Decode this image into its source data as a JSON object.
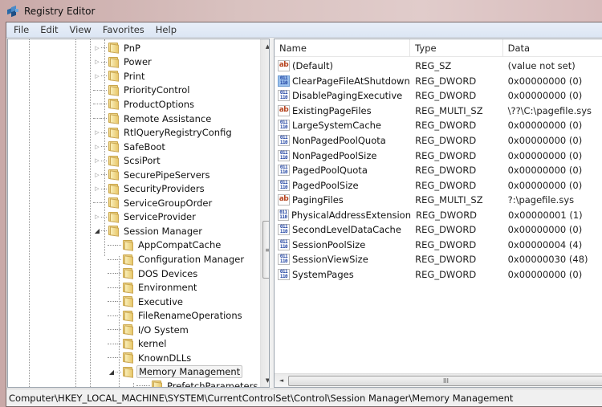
{
  "window": {
    "title": "Registry Editor",
    "icon": "regedit-icon"
  },
  "menu": [
    {
      "label": "File"
    },
    {
      "label": "Edit"
    },
    {
      "label": "View"
    },
    {
      "label": "Favorites"
    },
    {
      "label": "Help"
    }
  ],
  "tree": {
    "nodes": [
      {
        "label": "PnP",
        "level": 3,
        "expander": "collapsed"
      },
      {
        "label": "Power",
        "level": 3,
        "expander": "collapsed"
      },
      {
        "label": "Print",
        "level": 3,
        "expander": "collapsed"
      },
      {
        "label": "PriorityControl",
        "level": 3,
        "expander": "none"
      },
      {
        "label": "ProductOptions",
        "level": 3,
        "expander": "none"
      },
      {
        "label": "Remote Assistance",
        "level": 3,
        "expander": "none"
      },
      {
        "label": "RtlQueryRegistryConfig",
        "level": 3,
        "expander": "collapsed"
      },
      {
        "label": "SafeBoot",
        "level": 3,
        "expander": "collapsed"
      },
      {
        "label": "ScsiPort",
        "level": 3,
        "expander": "collapsed"
      },
      {
        "label": "SecurePipeServers",
        "level": 3,
        "expander": "collapsed"
      },
      {
        "label": "SecurityProviders",
        "level": 3,
        "expander": "collapsed"
      },
      {
        "label": "ServiceGroupOrder",
        "level": 3,
        "expander": "none"
      },
      {
        "label": "ServiceProvider",
        "level": 3,
        "expander": "collapsed"
      },
      {
        "label": "Session Manager",
        "level": 3,
        "expander": "expanded"
      },
      {
        "label": "AppCompatCache",
        "level": 4,
        "expander": "none"
      },
      {
        "label": "Configuration Manager",
        "level": 4,
        "expander": "none"
      },
      {
        "label": "DOS Devices",
        "level": 4,
        "expander": "none"
      },
      {
        "label": "Environment",
        "level": 4,
        "expander": "none"
      },
      {
        "label": "Executive",
        "level": 4,
        "expander": "none"
      },
      {
        "label": "FileRenameOperations",
        "level": 4,
        "expander": "none"
      },
      {
        "label": "I/O System",
        "level": 4,
        "expander": "none"
      },
      {
        "label": "kernel",
        "level": 4,
        "expander": "none"
      },
      {
        "label": "KnownDLLs",
        "level": 4,
        "expander": "none"
      },
      {
        "label": "Memory Management",
        "level": 4,
        "expander": "expanded",
        "selected": true
      },
      {
        "label": "PrefetchParameters",
        "level": 5,
        "expander": "none"
      }
    ]
  },
  "list": {
    "columns": {
      "name": "Name",
      "type": "Type",
      "data": "Data"
    },
    "rows": [
      {
        "icon": "string-value-icon",
        "name": "(Default)",
        "type": "REG_SZ",
        "data": "(value not set)"
      },
      {
        "icon": "binary-value-icon",
        "name": "ClearPageFileAtShutdown",
        "type": "REG_DWORD",
        "data": "0x00000000 (0)",
        "highlighted": true
      },
      {
        "icon": "binary-value-icon",
        "name": "DisablePagingExecutive",
        "type": "REG_DWORD",
        "data": "0x00000000 (0)"
      },
      {
        "icon": "string-value-icon",
        "name": "ExistingPageFiles",
        "type": "REG_MULTI_SZ",
        "data": "\\??\\C:\\pagefile.sys"
      },
      {
        "icon": "binary-value-icon",
        "name": "LargeSystemCache",
        "type": "REG_DWORD",
        "data": "0x00000000 (0)"
      },
      {
        "icon": "binary-value-icon",
        "name": "NonPagedPoolQuota",
        "type": "REG_DWORD",
        "data": "0x00000000 (0)"
      },
      {
        "icon": "binary-value-icon",
        "name": "NonPagedPoolSize",
        "type": "REG_DWORD",
        "data": "0x00000000 (0)"
      },
      {
        "icon": "binary-value-icon",
        "name": "PagedPoolQuota",
        "type": "REG_DWORD",
        "data": "0x00000000 (0)"
      },
      {
        "icon": "binary-value-icon",
        "name": "PagedPoolSize",
        "type": "REG_DWORD",
        "data": "0x00000000 (0)"
      },
      {
        "icon": "string-value-icon",
        "name": "PagingFiles",
        "type": "REG_MULTI_SZ",
        "data": "?:\\pagefile.sys"
      },
      {
        "icon": "binary-value-icon",
        "name": "PhysicalAddressExtension",
        "type": "REG_DWORD",
        "data": "0x00000001 (1)"
      },
      {
        "icon": "binary-value-icon",
        "name": "SecondLevelDataCache",
        "type": "REG_DWORD",
        "data": "0x00000000 (0)"
      },
      {
        "icon": "binary-value-icon",
        "name": "SessionPoolSize",
        "type": "REG_DWORD",
        "data": "0x00000004 (4)"
      },
      {
        "icon": "binary-value-icon",
        "name": "SessionViewSize",
        "type": "REG_DWORD",
        "data": "0x00000030 (48)"
      },
      {
        "icon": "binary-value-icon",
        "name": "SystemPages",
        "type": "REG_DWORD",
        "data": "0x00000000 (0)"
      }
    ]
  },
  "icons": {
    "string_glyph": "ab",
    "binary_glyph": "011\n110",
    "scroll_up": "▲",
    "scroll_down": "▼",
    "scroll_left": "◄",
    "grip_v": "≡",
    "grip_h": "III",
    "expander_collapsed": "▷",
    "expander_expanded": "◢"
  },
  "statusbar": {
    "path": "Computer\\HKEY_LOCAL_MACHINE\\SYSTEM\\CurrentControlSet\\Control\\Session Manager\\Memory Management"
  }
}
